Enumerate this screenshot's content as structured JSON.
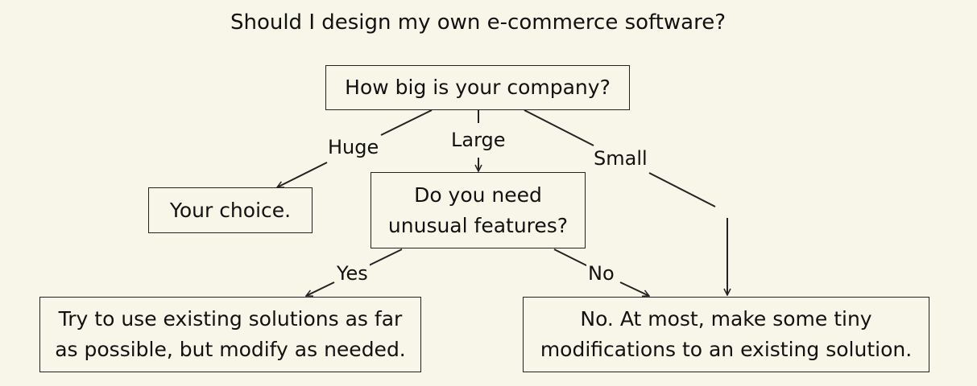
{
  "title": "Should I design my own e-commerce software?",
  "nodes": {
    "company_size": "How big is your company?",
    "your_choice": "Your choice.",
    "unusual_features": "Do you need\nunusual features?",
    "existing_modify": "Try to use existing solutions as far\nas possible, but modify as needed.",
    "tiny_modifications": "No.  At most, make some tiny\nmodifications to an existing solution."
  },
  "edges": {
    "huge": "Huge",
    "large": "Large",
    "small": "Small",
    "yes": "Yes",
    "no": "No"
  }
}
